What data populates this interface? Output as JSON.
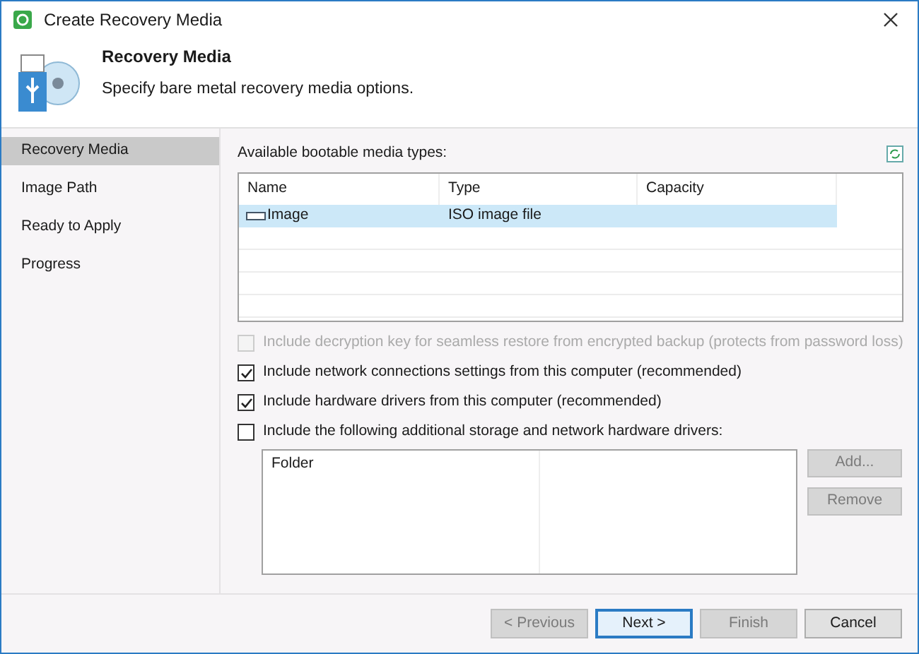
{
  "window": {
    "title": "Create Recovery Media"
  },
  "header": {
    "title": "Recovery Media",
    "subtitle": "Specify bare metal recovery media options."
  },
  "sidebar": {
    "items": [
      {
        "label": "Recovery Media",
        "selected": true
      },
      {
        "label": "Image Path",
        "selected": false
      },
      {
        "label": "Ready to Apply",
        "selected": false
      },
      {
        "label": "Progress",
        "selected": false
      }
    ]
  },
  "media_types": {
    "label": "Available bootable media types:",
    "columns": [
      "Name",
      "Type",
      "Capacity"
    ],
    "rows": [
      {
        "name": "Image",
        "type": "ISO image file",
        "capacity": "",
        "selected": true
      }
    ]
  },
  "options": [
    {
      "label": "Include decryption key for seamless restore from encrypted backup (protects from password loss)",
      "checked": false,
      "disabled": true
    },
    {
      "label": "Include network connections settings from this computer (recommended)",
      "checked": true,
      "disabled": false
    },
    {
      "label": "Include hardware drivers from this computer (recommended)",
      "checked": true,
      "disabled": false
    },
    {
      "label": "Include the following additional storage and network hardware drivers:",
      "checked": false,
      "disabled": false
    }
  ],
  "drivers": {
    "columns": [
      "Folder"
    ],
    "buttons": [
      {
        "label": "Add...",
        "disabled": true
      },
      {
        "label": "Remove",
        "disabled": true
      }
    ]
  },
  "footer_buttons": [
    {
      "label": "< Previous",
      "disabled": true,
      "default": false
    },
    {
      "label": "Next >",
      "disabled": false,
      "default": true
    },
    {
      "label": "Finish",
      "disabled": true,
      "default": false
    },
    {
      "label": "Cancel",
      "disabled": false,
      "default": false
    }
  ]
}
